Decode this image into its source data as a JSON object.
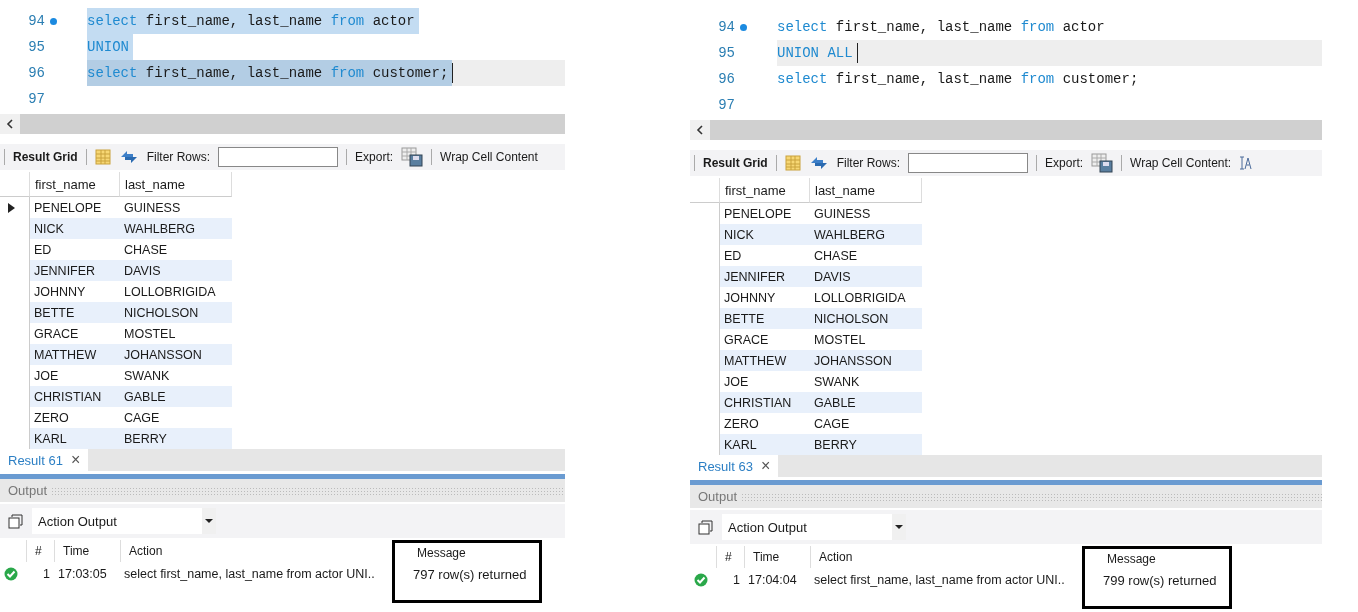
{
  "panels": [
    {
      "editor": {
        "lines": [
          {
            "number": "94",
            "marker": true,
            "selected": true,
            "current": false,
            "tokens": [
              {
                "kind": "keyword",
                "text": "select"
              },
              {
                "kind": "plain",
                "text": " first_name, last_name "
              },
              {
                "kind": "keyword",
                "text": "from"
              },
              {
                "kind": "plain",
                "text": " actor"
              }
            ]
          },
          {
            "number": "95",
            "marker": false,
            "selected": true,
            "current": false,
            "tokens": [
              {
                "kind": "keyword",
                "text": "UNION"
              }
            ]
          },
          {
            "number": "96",
            "marker": false,
            "selected": true,
            "current": true,
            "tokens": [
              {
                "kind": "keyword",
                "text": "select"
              },
              {
                "kind": "plain",
                "text": " first_name, last_name "
              },
              {
                "kind": "keyword",
                "text": "from"
              },
              {
                "kind": "plain",
                "text": " customer;"
              }
            ]
          },
          {
            "number": "97",
            "marker": false,
            "selected": false,
            "current": false
          }
        ]
      },
      "toolbar": {
        "result_grid": "Result Grid",
        "filter_label": "Filter Rows:",
        "export_label": "Export:",
        "wrap_label": "Wrap Cell Content"
      },
      "grid": {
        "columns": [
          "first_name",
          "last_name"
        ],
        "rows": [
          {
            "current": true,
            "cells": [
              "PENELOPE",
              "GUINESS"
            ]
          },
          {
            "current": false,
            "cells": [
              "NICK",
              "WAHLBERG"
            ]
          },
          {
            "current": false,
            "cells": [
              "ED",
              "CHASE"
            ]
          },
          {
            "current": false,
            "cells": [
              "JENNIFER",
              "DAVIS"
            ]
          },
          {
            "current": false,
            "cells": [
              "JOHNNY",
              "LOLLOBRIGIDA"
            ]
          },
          {
            "current": false,
            "cells": [
              "BETTE",
              "NICHOLSON"
            ]
          },
          {
            "current": false,
            "cells": [
              "GRACE",
              "MOSTEL"
            ]
          },
          {
            "current": false,
            "cells": [
              "MATTHEW",
              "JOHANSSON"
            ]
          },
          {
            "current": false,
            "cells": [
              "JOE",
              "SWANK"
            ]
          },
          {
            "current": false,
            "cells": [
              "CHRISTIAN",
              "GABLE"
            ]
          },
          {
            "current": false,
            "cells": [
              "ZERO",
              "CAGE"
            ]
          },
          {
            "current": false,
            "cells": [
              "KARL",
              "BERRY"
            ]
          }
        ]
      },
      "result_tab": {
        "label": "Result 61",
        "close": "×"
      },
      "output": {
        "title": "Output",
        "selector": "Action Output",
        "columns": [
          "#",
          "Time",
          "Action",
          "Message"
        ],
        "message_outlined": true,
        "entries": [
          {
            "kind": "success",
            "number": "1",
            "time": "17:03:05",
            "action": "select first_name, last_name from actor UNI..",
            "message": "797 row(s) returned"
          }
        ]
      }
    },
    {
      "editor": {
        "lines": [
          {
            "number": "94",
            "marker": true,
            "selected": false,
            "current": false,
            "tokens": [
              {
                "kind": "keyword",
                "text": "select"
              },
              {
                "kind": "plain",
                "text": " first_name, last_name "
              },
              {
                "kind": "keyword",
                "text": "from"
              },
              {
                "kind": "plain",
                "text": " actor"
              }
            ]
          },
          {
            "number": "95",
            "marker": false,
            "selected": false,
            "current": true,
            "tokens": [
              {
                "kind": "keyword",
                "text": "UNION ALL"
              }
            ]
          },
          {
            "number": "96",
            "marker": false,
            "selected": false,
            "current": false,
            "tokens": [
              {
                "kind": "keyword",
                "text": "select"
              },
              {
                "kind": "plain",
                "text": " first_name, last_name "
              },
              {
                "kind": "keyword",
                "text": "from"
              },
              {
                "kind": "plain",
                "text": " customer;"
              }
            ]
          },
          {
            "number": "97",
            "marker": false,
            "selected": false,
            "current": false
          }
        ]
      },
      "toolbar": {
        "result_grid": "Result Grid",
        "filter_label": "Filter Rows:",
        "export_label": "Export:",
        "wrap_label": "Wrap Cell Content:",
        "wrap_icon": true
      },
      "grid": {
        "columns": [
          "first_name",
          "last_name"
        ],
        "rows": [
          {
            "current": false,
            "cells": [
              "PENELOPE",
              "GUINESS"
            ]
          },
          {
            "current": false,
            "cells": [
              "NICK",
              "WAHLBERG"
            ]
          },
          {
            "current": false,
            "cells": [
              "ED",
              "CHASE"
            ]
          },
          {
            "current": false,
            "cells": [
              "JENNIFER",
              "DAVIS"
            ]
          },
          {
            "current": false,
            "cells": [
              "JOHNNY",
              "LOLLOBRIGIDA"
            ]
          },
          {
            "current": false,
            "cells": [
              "BETTE",
              "NICHOLSON"
            ]
          },
          {
            "current": false,
            "cells": [
              "GRACE",
              "MOSTEL"
            ]
          },
          {
            "current": false,
            "cells": [
              "MATTHEW",
              "JOHANSSON"
            ]
          },
          {
            "current": false,
            "cells": [
              "JOE",
              "SWANK"
            ]
          },
          {
            "current": false,
            "cells": [
              "CHRISTIAN",
              "GABLE"
            ]
          },
          {
            "current": false,
            "cells": [
              "ZERO",
              "CAGE"
            ]
          },
          {
            "current": false,
            "cells": [
              "KARL",
              "BERRY"
            ]
          }
        ]
      },
      "result_tab": {
        "label": "Result 63",
        "close": "×"
      },
      "output": {
        "title": "Output",
        "selector": "Action Output",
        "columns": [
          "#",
          "Time",
          "Action",
          "Message"
        ],
        "message_outlined": true,
        "entries": [
          {
            "kind": "success",
            "number": "1",
            "time": "17:04:04",
            "action": "select first_name, last_name from actor UNI..",
            "message": "799 row(s) returned"
          }
        ]
      }
    }
  ]
}
